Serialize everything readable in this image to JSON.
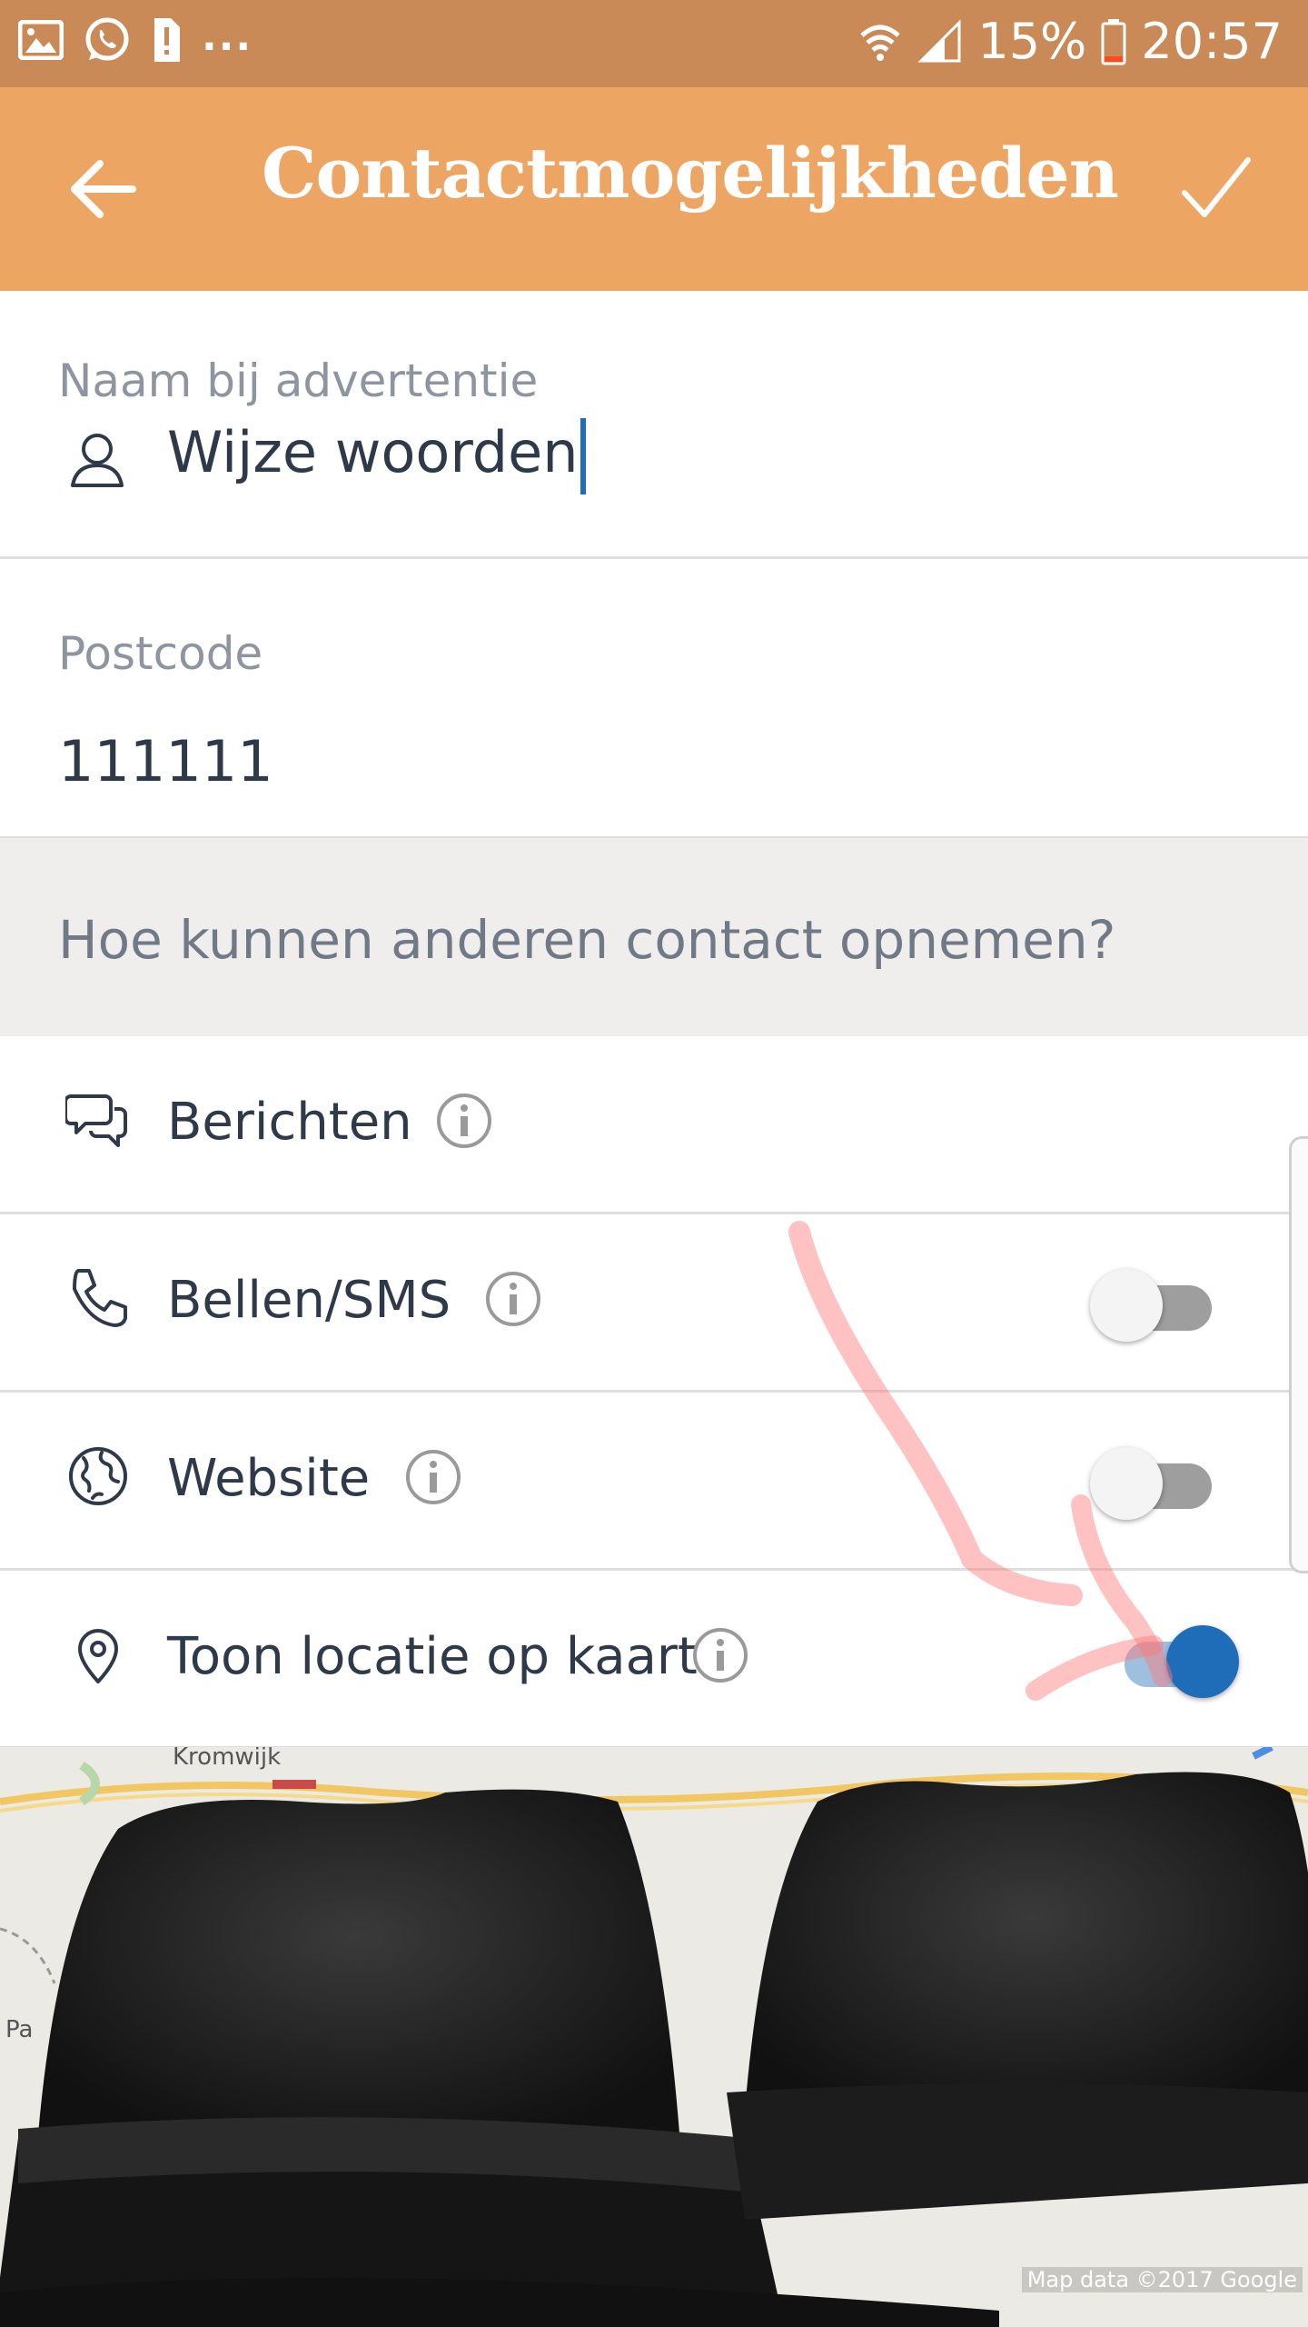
{
  "status_bar": {
    "icons_left": [
      "gallery-icon",
      "whatsapp-icon",
      "sim-alert-icon"
    ],
    "more": "...",
    "battery_percent": "15%",
    "time": "20:57",
    "icons_right": [
      "wifi-icon",
      "signal-icon",
      "battery-icon"
    ]
  },
  "app_bar": {
    "title": "Contactmogelijkheden",
    "back_icon": "arrow-left-icon",
    "confirm_icon": "check-icon",
    "background": "#eda564"
  },
  "name_field": {
    "label": "Naam bij advertentie",
    "value": "Wijze woorden",
    "icon": "person-icon"
  },
  "postcode_field": {
    "label": "Postcode",
    "value": "111111"
  },
  "contact_section": {
    "heading": "Hoe kunnen anderen contact opnemen?"
  },
  "contact_options": [
    {
      "label": "Berichten",
      "icon": "chat-icon",
      "has_toggle": false
    },
    {
      "label": "Bellen/SMS",
      "icon": "phone-icon",
      "has_toggle": true,
      "enabled": false
    },
    {
      "label": "Website",
      "icon": "globe-icon",
      "has_toggle": true,
      "enabled": false
    },
    {
      "label": "Toon locatie op kaart",
      "icon": "location-pin-icon",
      "has_toggle": true,
      "enabled": true
    }
  ],
  "map": {
    "places": [
      "Kromwijk",
      "Pa"
    ],
    "credit": "Map data ©2017 Google"
  },
  "colors": {
    "accent": "#1f6cb8",
    "status_bar": "#c98a57"
  }
}
